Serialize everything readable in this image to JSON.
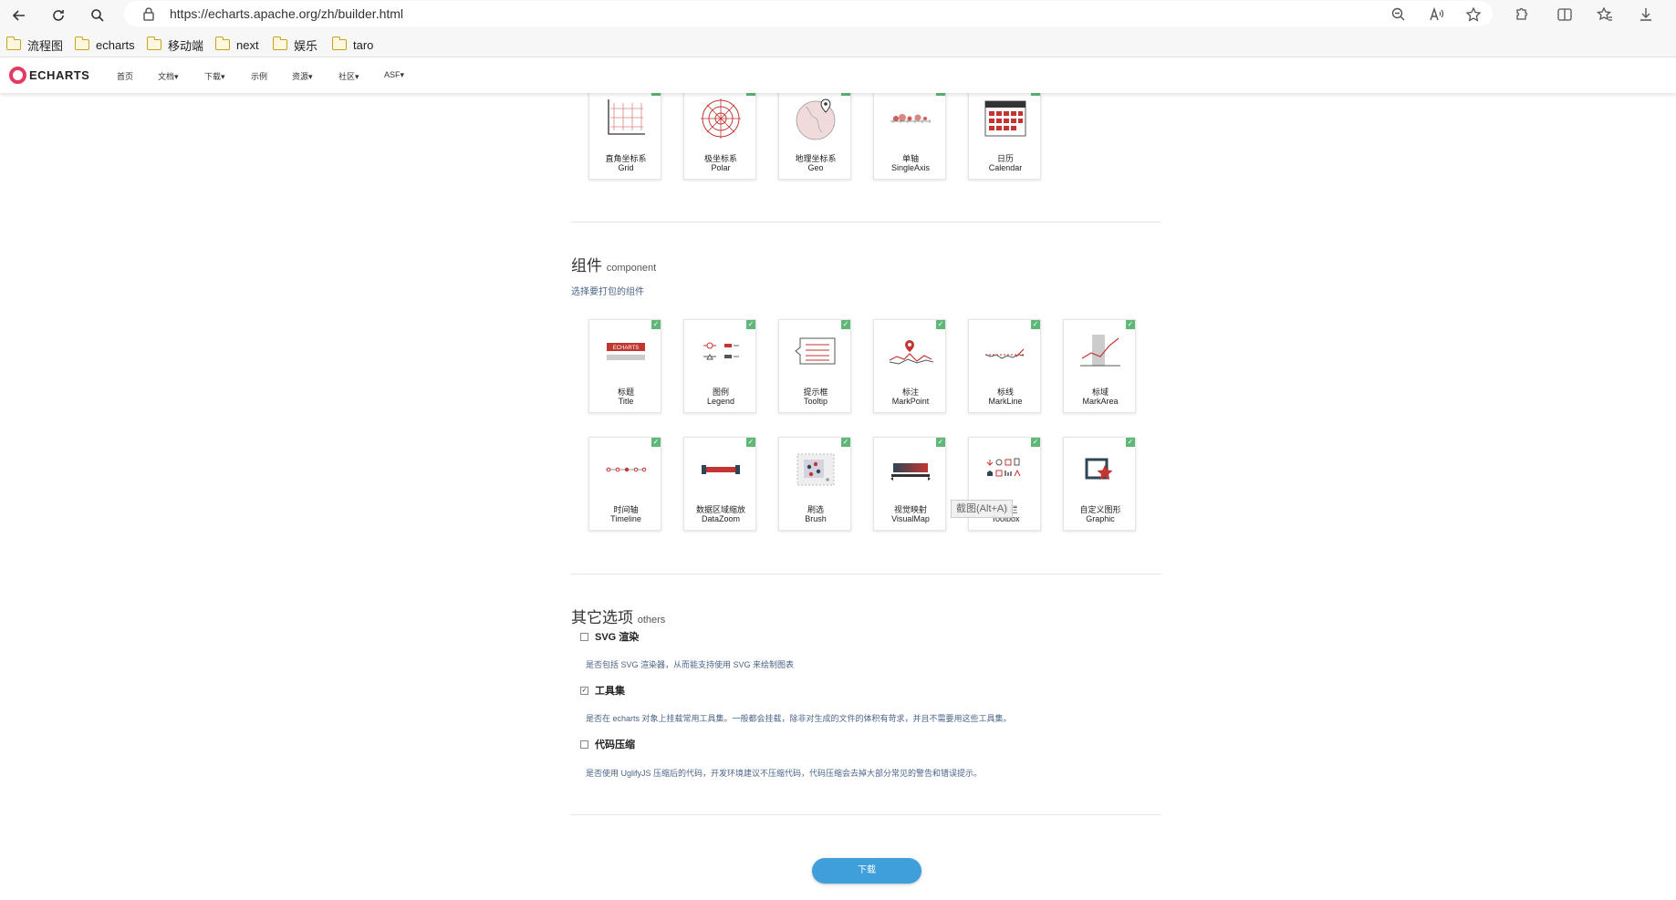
{
  "browser": {
    "url": "https://echarts.apache.org/zh/builder.html",
    "bookmarks": [
      "流程图",
      "echarts",
      "移动端",
      "next",
      "娱乐",
      "taro"
    ]
  },
  "site_nav": {
    "logo": "ECHARTS",
    "links": [
      "首页",
      "文档",
      "下载",
      "示例",
      "资源",
      "社区",
      "ASF"
    ]
  },
  "coords": {
    "cards": [
      {
        "zh": "直角坐标系",
        "en": "Grid",
        "icon": "grid-chart-icon"
      },
      {
        "zh": "极坐标系",
        "en": "Polar",
        "icon": "polar-chart-icon"
      },
      {
        "zh": "地理坐标系",
        "en": "Geo",
        "icon": "geo-map-icon"
      },
      {
        "zh": "单轴",
        "en": "SingleAxis",
        "icon": "single-axis-icon"
      },
      {
        "zh": "日历",
        "en": "Calendar",
        "icon": "calendar-icon"
      }
    ]
  },
  "components": {
    "title": "组件",
    "title_en": "component",
    "subtitle": "选择要打包的组件",
    "row1": [
      {
        "zh": "标题",
        "en": "Title",
        "icon": "title-icon"
      },
      {
        "zh": "图例",
        "en": "Legend",
        "icon": "legend-icon"
      },
      {
        "zh": "提示框",
        "en": "Tooltip",
        "icon": "tooltip-icon"
      },
      {
        "zh": "标注",
        "en": "MarkPoint",
        "icon": "mark-point-icon"
      },
      {
        "zh": "标线",
        "en": "MarkLine",
        "icon": "mark-line-icon"
      },
      {
        "zh": "标域",
        "en": "MarkArea",
        "icon": "mark-area-icon"
      }
    ],
    "row2": [
      {
        "zh": "时间轴",
        "en": "Timeline",
        "icon": "timeline-icon"
      },
      {
        "zh": "数据区域缩放",
        "en": "DataZoom",
        "icon": "data-zoom-icon"
      },
      {
        "zh": "刷选",
        "en": "Brush",
        "icon": "brush-icon"
      },
      {
        "zh": "视觉映射",
        "en": "VisualMap",
        "icon": "visual-map-icon"
      },
      {
        "zh": "工具栏",
        "en": "Toolbox",
        "icon": "toolbox-icon"
      },
      {
        "zh": "自定义图形",
        "en": "Graphic",
        "icon": "graphic-icon"
      }
    ]
  },
  "others": {
    "title": "其它选项",
    "title_en": "others",
    "options": [
      {
        "label": "SVG 渲染",
        "checked": false,
        "desc": "是否包括 SVG 渲染器，从而能支持使用 SVG 来绘制图表"
      },
      {
        "label": "工具集",
        "checked": true,
        "desc": "是否在 echarts 对象上挂载常用工具集。一般都会挂载，除非对生成的文件的体积有苛求，并且不需要用这些工具集。"
      },
      {
        "label": "代码压缩",
        "checked": false,
        "desc": "是否使用 UglifyJS 压缩后的代码，开发环境建议不压缩代码，代码压缩会去掉大部分常见的警告和错误提示。"
      }
    ]
  },
  "download_label": "下载",
  "tooltip_text": "截图(Alt+A)",
  "colors": {
    "accent": "#e43961",
    "button": "#3f9fdb",
    "check": "#5fb878",
    "icon_red": "#c23531"
  }
}
